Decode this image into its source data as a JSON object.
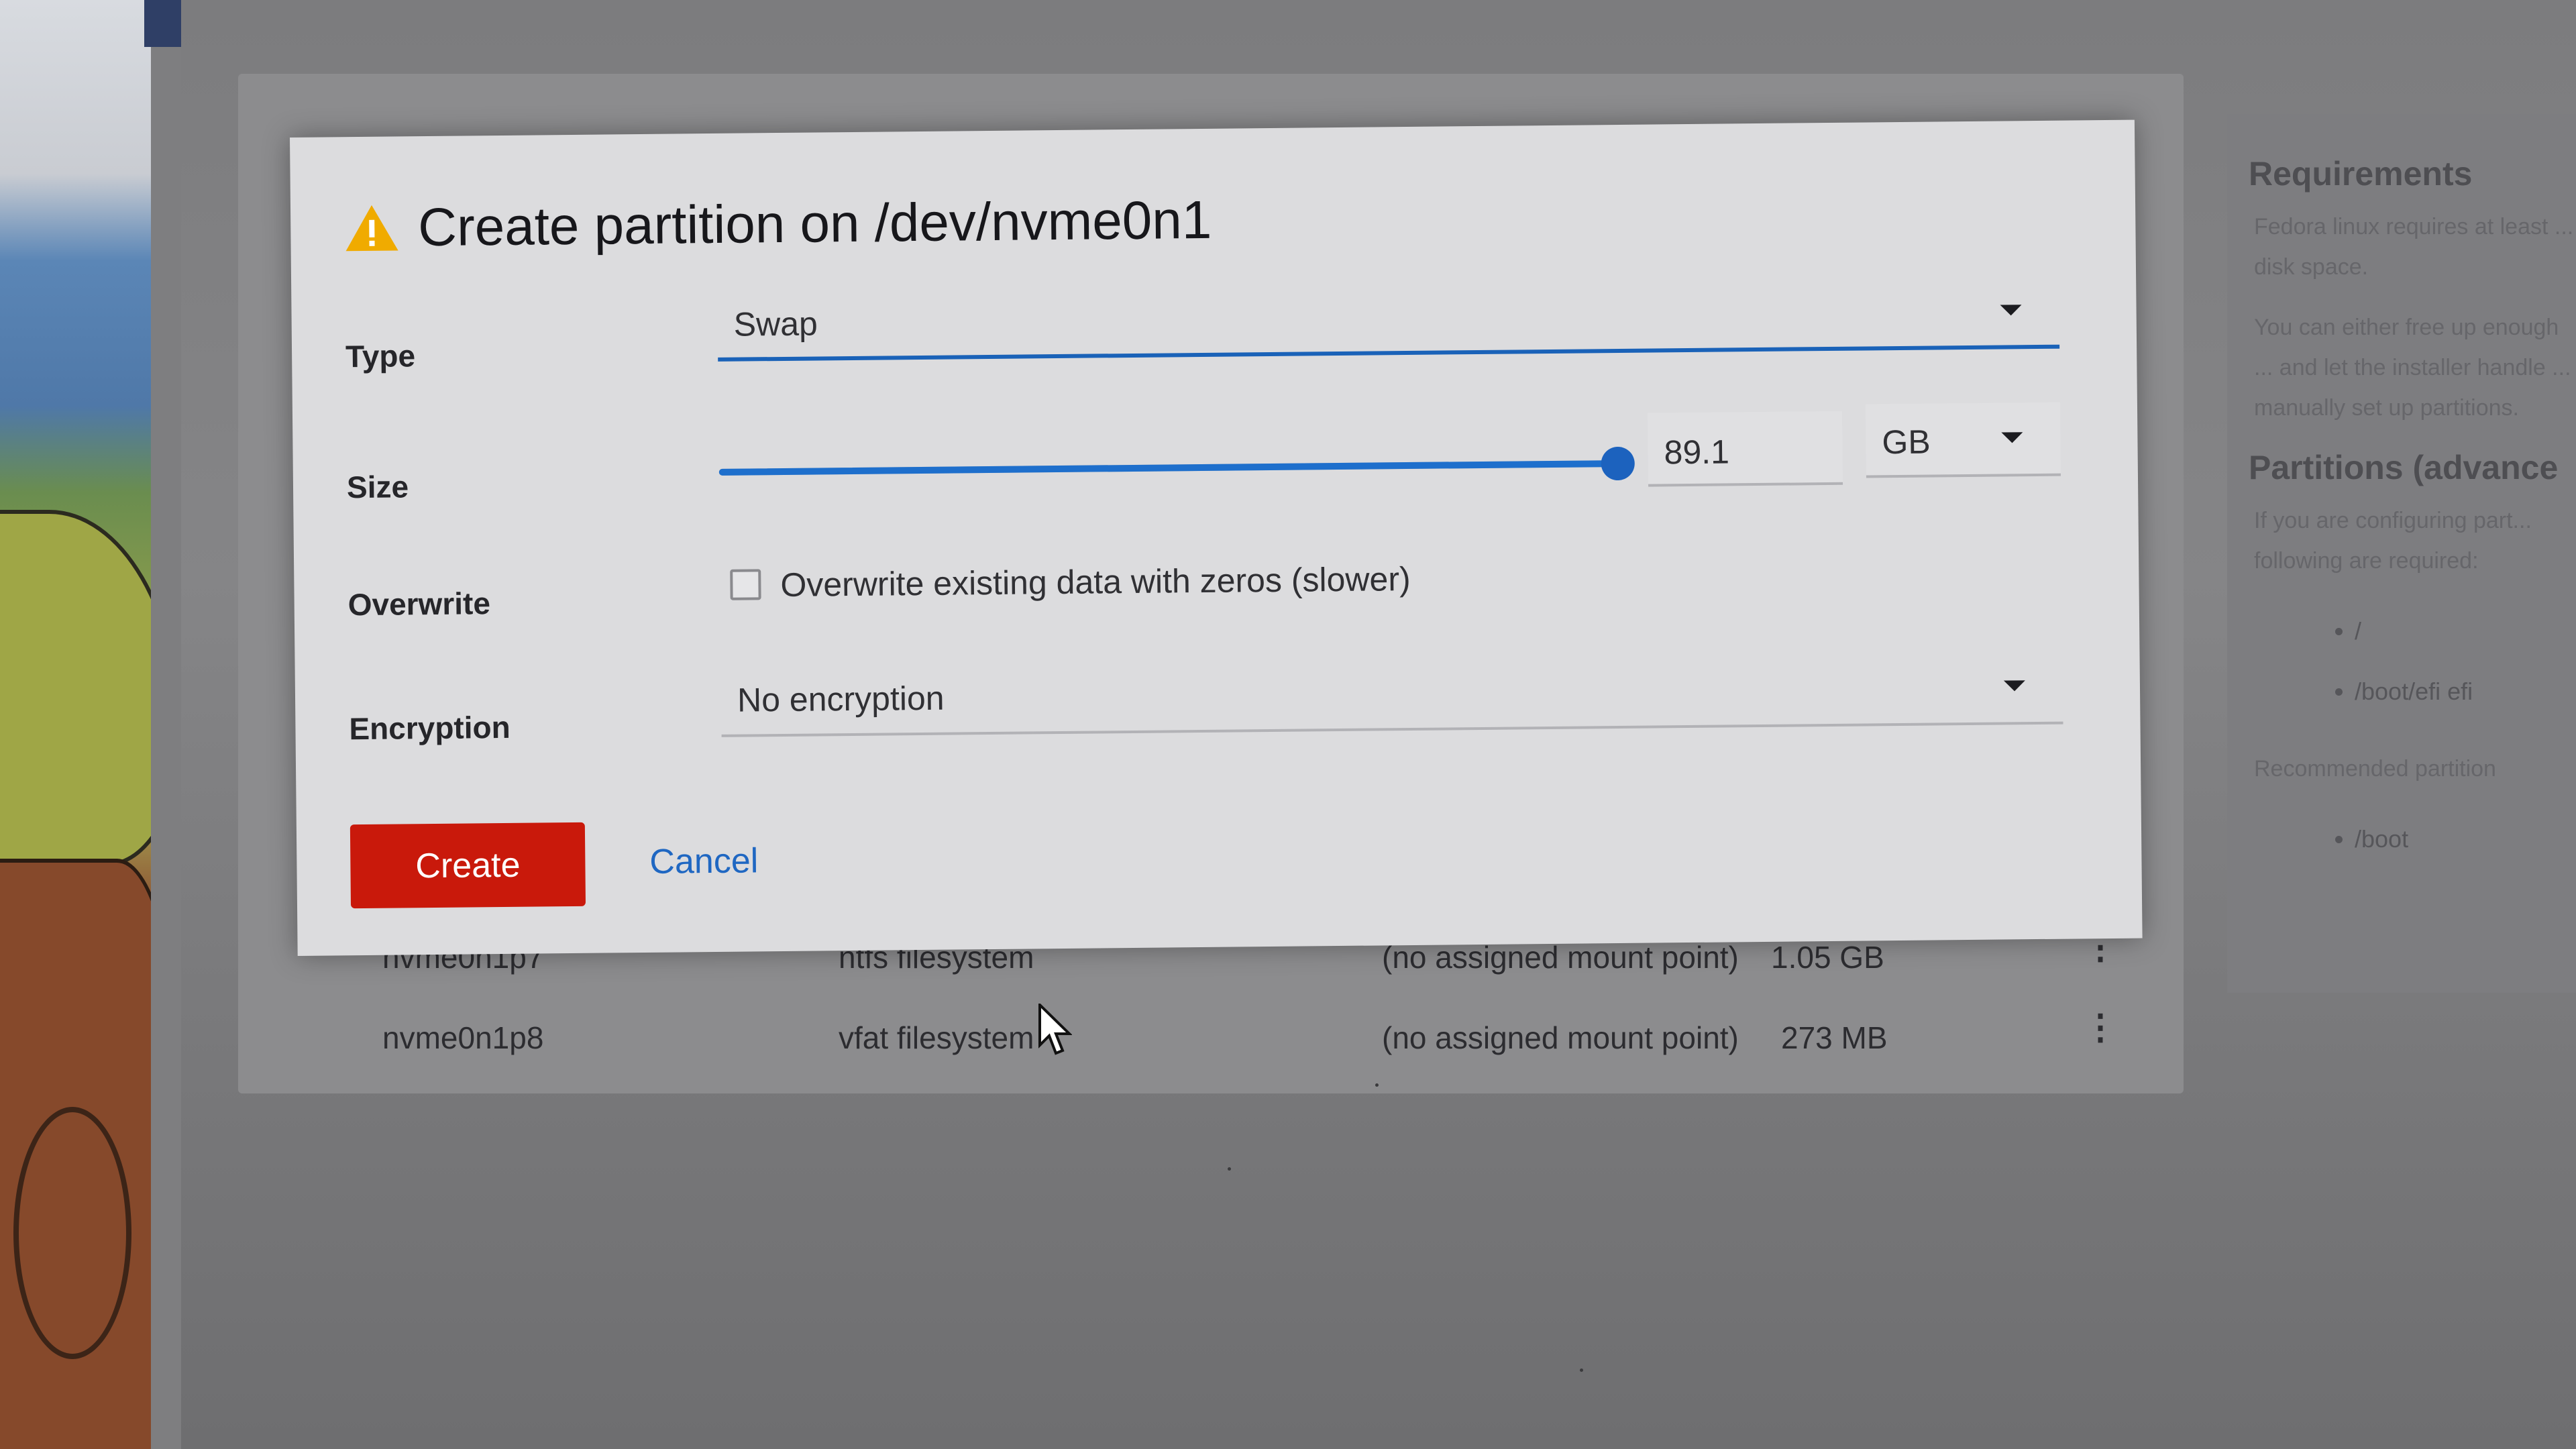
{
  "dialog": {
    "title": "Create partition on /dev/nvme0n1",
    "type_label": "Type",
    "type_value": "Swap",
    "size_label": "Size",
    "size_value": "89.1",
    "size_fraction": 1.0,
    "size_unit": "GB",
    "overwrite_label": "Overwrite",
    "overwrite_checkbox_label": "Overwrite existing data with zeros (slower)",
    "overwrite_checked": false,
    "encryption_label": "Encryption",
    "encryption_value": "No encryption",
    "create_button": "Create",
    "cancel_button": "Cancel"
  },
  "partitions": [
    {
      "name": "nvme0n1p7",
      "filesystem": "ntfs filesystem",
      "mount": "(no assigned mount point)",
      "size": "1.05 GB"
    },
    {
      "name": "nvme0n1p8",
      "filesystem": "vfat filesystem",
      "mount": "(no assigned mount point)",
      "size": "273 MB"
    }
  ],
  "sidebar": {
    "requirements_title": "Requirements",
    "requirements_text_1": "Fedora linux requires at least ... disk space.",
    "requirements_text_2": "You can either free up enough ... and let the installer handle ... manually set up partitions.",
    "partitions_title": "Partitions (advance",
    "partitions_text": "If you are configuring part... following are required:",
    "required_mounts": [
      "/",
      "/boot/efi efi"
    ],
    "recommended_title": "Recommended partition",
    "recommended_mounts": [
      "/boot"
    ]
  },
  "colors": {
    "primary_danger": "#c9190b",
    "link": "#1f67c2",
    "slider": "#1e6fcc",
    "warning_icon": "#f0ab00"
  },
  "icons": {
    "title_icon": "warning-triangle-icon",
    "dropdown_icon": "caret-down-icon",
    "row_menu_icon": "kebab-icon"
  }
}
